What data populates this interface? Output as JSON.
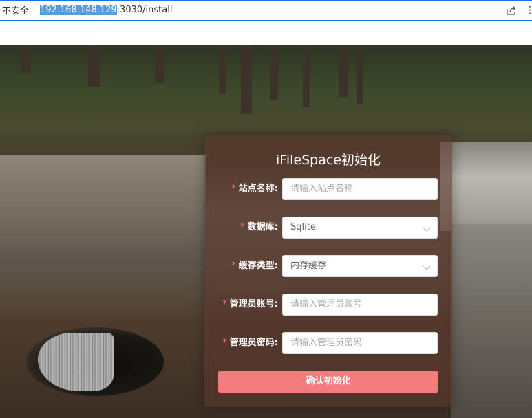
{
  "browser": {
    "security_label": "不安全",
    "url_host": "192.168.148.129",
    "url_rest": ":3030/install",
    "icons": {
      "share": "share-icon",
      "more": "more-icon"
    }
  },
  "install": {
    "title": "iFileSpace初始化",
    "required_marker": "*",
    "fields": [
      {
        "label": "站点名称:",
        "type": "input",
        "placeholder": "请输入站点名称",
        "value": ""
      },
      {
        "label": "数据库:",
        "type": "select",
        "value": "Sqlite"
      },
      {
        "label": "缓存类型:",
        "type": "select",
        "value": "内存缓存"
      },
      {
        "label": "管理员账号:",
        "type": "input",
        "placeholder": "请输入管理员账号",
        "value": ""
      },
      {
        "label": "管理员密码:",
        "type": "input",
        "placeholder": "请输入管理员密码",
        "value": ""
      }
    ],
    "submit_label": "确认初始化"
  },
  "colors": {
    "accent": "#1a73e8",
    "submit": "#f47c7c",
    "required": "#f56c6c"
  }
}
